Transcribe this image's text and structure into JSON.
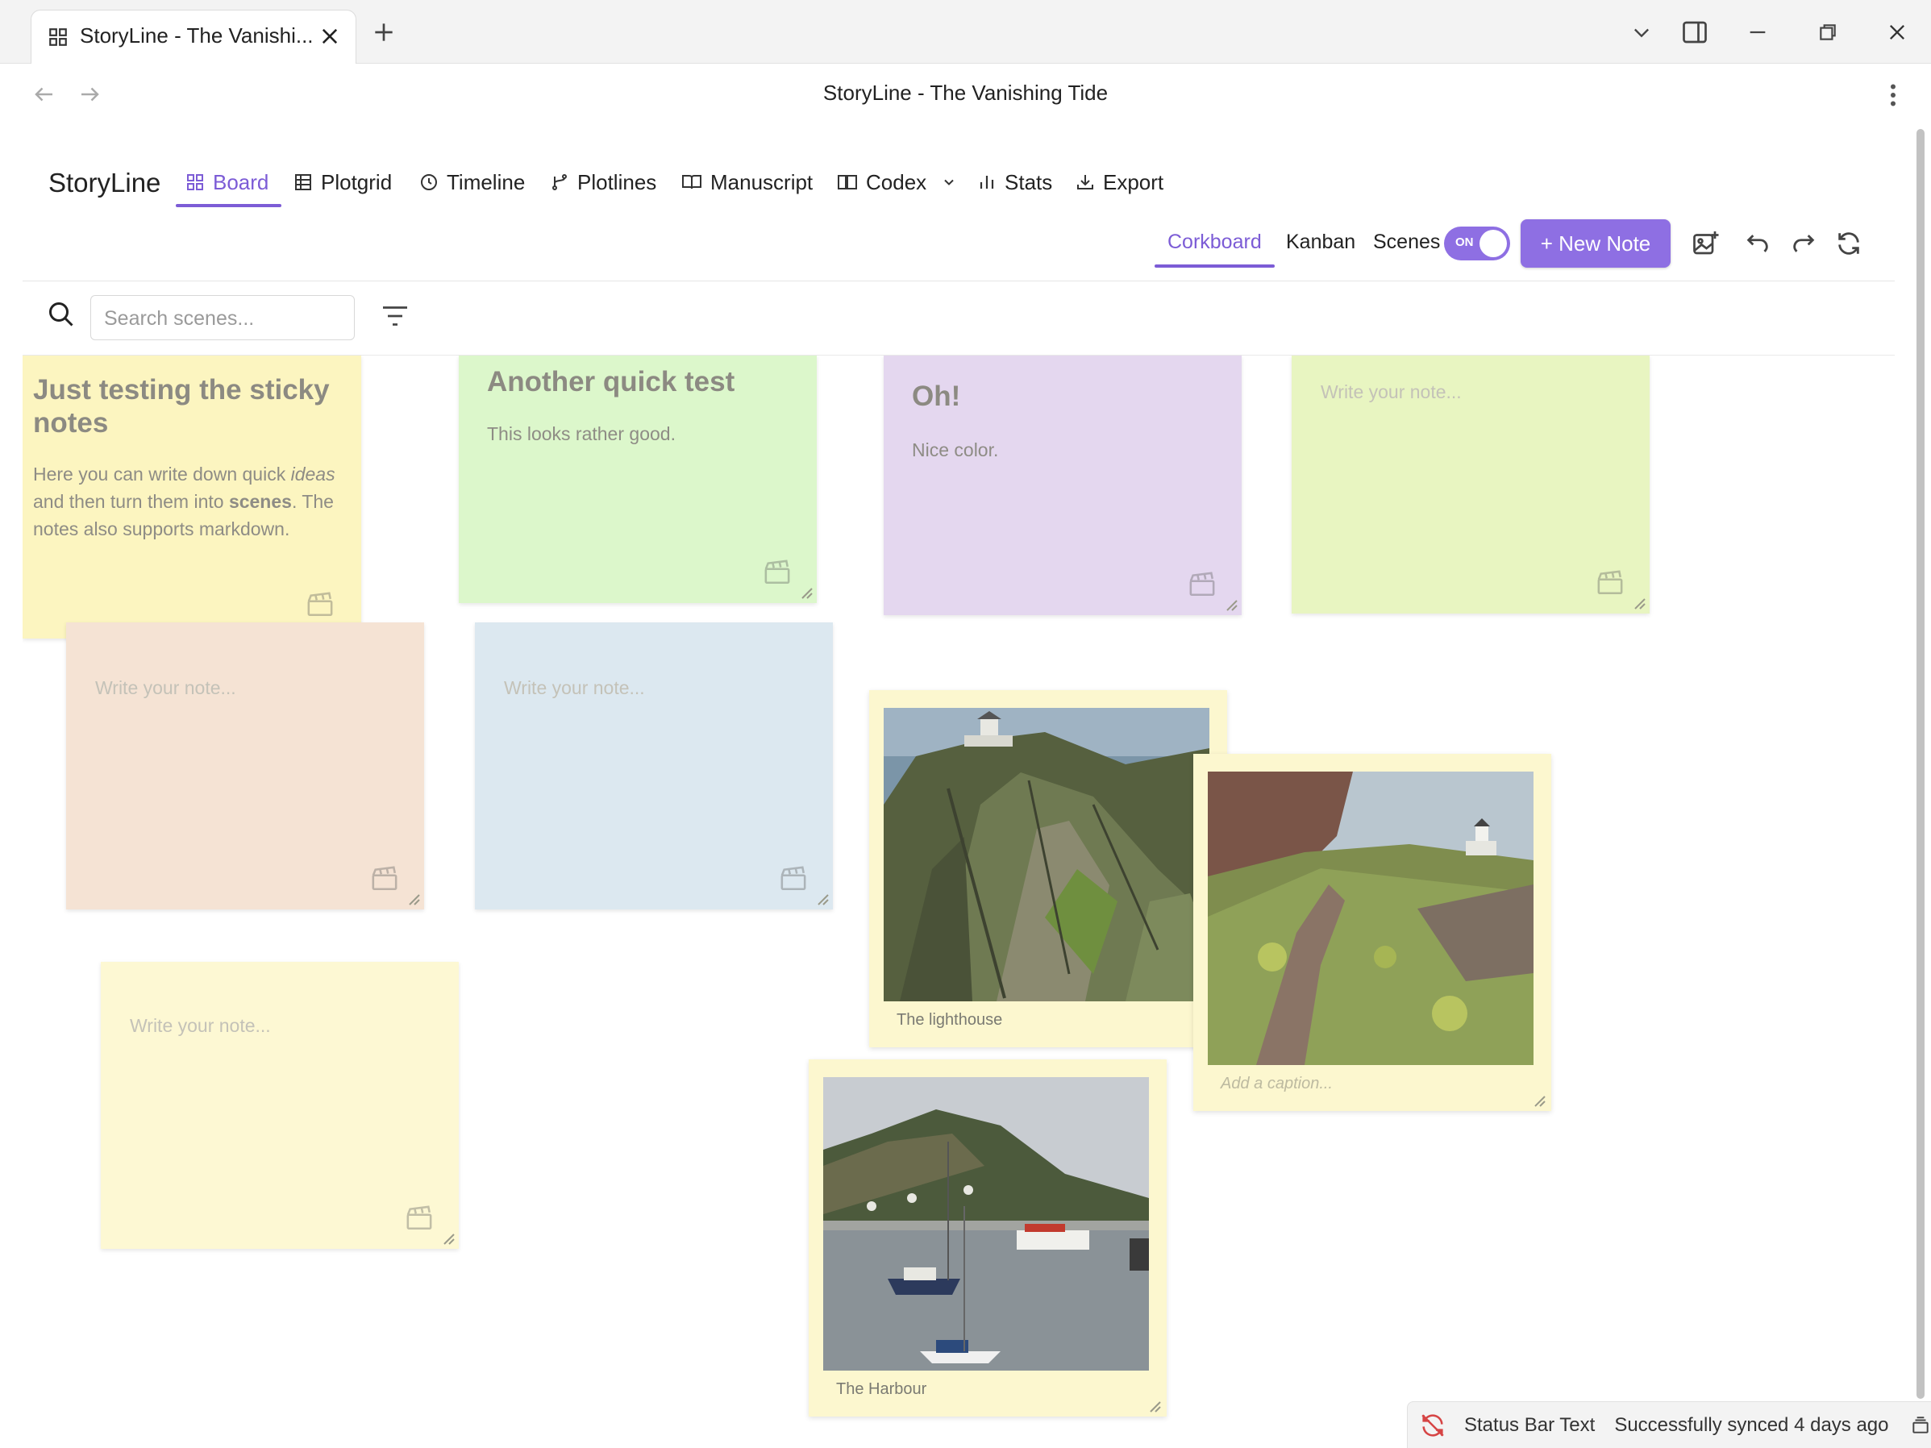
{
  "browser": {
    "tab_title": "StoryLine - The Vanishi...",
    "page_title": "StoryLine - The Vanishing Tide"
  },
  "app": {
    "brand": "StoryLine",
    "nav": [
      {
        "label": "Board",
        "icon": "grid-icon",
        "active": true
      },
      {
        "label": "Plotgrid",
        "icon": "table-icon"
      },
      {
        "label": "Timeline",
        "icon": "clock-icon"
      },
      {
        "label": "Plotlines",
        "icon": "branch-icon"
      },
      {
        "label": "Manuscript",
        "icon": "book-open-icon"
      },
      {
        "label": "Codex",
        "icon": "book-icon"
      },
      {
        "label": "Stats",
        "icon": "bar-chart-icon"
      },
      {
        "label": "Export",
        "icon": "download-icon"
      }
    ]
  },
  "toolbar": {
    "views": [
      "Corkboard",
      "Kanban"
    ],
    "active_view": "Corkboard",
    "scenes_label": "Scenes",
    "scenes_toggle": "ON",
    "new_note_label": "+ New Note"
  },
  "search": {
    "placeholder": "Search scenes..."
  },
  "notes": [
    {
      "title": "Just testing the sticky notes",
      "body_parts": [
        "Here you can write down quick ",
        "ideas",
        " and then turn them into ",
        "scenes",
        ". The notes also supports markdown."
      ],
      "color": "#fcf5c0"
    },
    {
      "title": "Another quick test",
      "body": "This looks rather good.",
      "color": "#dcf7cb"
    },
    {
      "title": "Oh!",
      "body": "Nice color.",
      "color": "#e4d7ef"
    },
    {
      "placeholder": "Write your note...",
      "color": "#e8f5c1"
    },
    {
      "placeholder": "Write your note...",
      "color": "#f5e3d4"
    },
    {
      "placeholder": "Write your note...",
      "color": "#dce8f0"
    },
    {
      "placeholder": "Write your note...",
      "color": "#fdf8d3"
    }
  ],
  "photos": [
    {
      "caption": "The lighthouse"
    },
    {
      "caption_placeholder": "Add a caption..."
    },
    {
      "caption": "The Harbour"
    }
  ],
  "status_bar": {
    "text": "Status Bar Text",
    "sync": "Successfully synced 4 days ago"
  },
  "colors": {
    "accent": "#8e6fe3",
    "active_tab": "#7c5cd6"
  }
}
